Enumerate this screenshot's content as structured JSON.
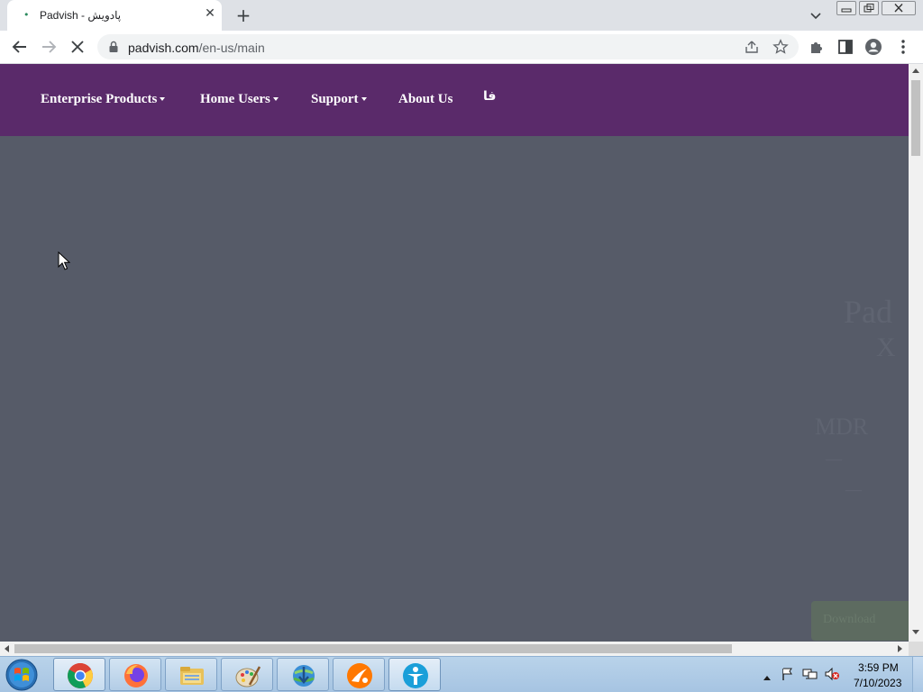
{
  "browser": {
    "tab": {
      "title": "Padvish - پادویش",
      "favicon": "padvish-favicon"
    },
    "address_bar": {
      "domain": "padvish.com",
      "path": "/en-us/main"
    },
    "loading": true
  },
  "site": {
    "nav": {
      "items": [
        {
          "label": "Enterprise Products",
          "has_dropdown": true
        },
        {
          "label": "Home Users",
          "has_dropdown": true
        },
        {
          "label": "Support",
          "has_dropdown": true
        },
        {
          "label": "About Us",
          "has_dropdown": false
        }
      ],
      "language_switch": "فا"
    },
    "colors": {
      "nav_background": "#5a2a6a",
      "overlay": "#565b68"
    }
  },
  "taskbar": {
    "apps": [
      {
        "name": "chrome-icon",
        "active": true
      },
      {
        "name": "firefox-icon",
        "active": false
      },
      {
        "name": "file-explorer-icon",
        "active": false
      },
      {
        "name": "paint-icon",
        "active": false
      },
      {
        "name": "download-manager-icon",
        "active": false
      },
      {
        "name": "avast-icon",
        "active": false
      },
      {
        "name": "teamviewer-icon",
        "active": true
      }
    ],
    "clock": {
      "time": "3:59 PM",
      "date": "7/10/2023"
    }
  }
}
